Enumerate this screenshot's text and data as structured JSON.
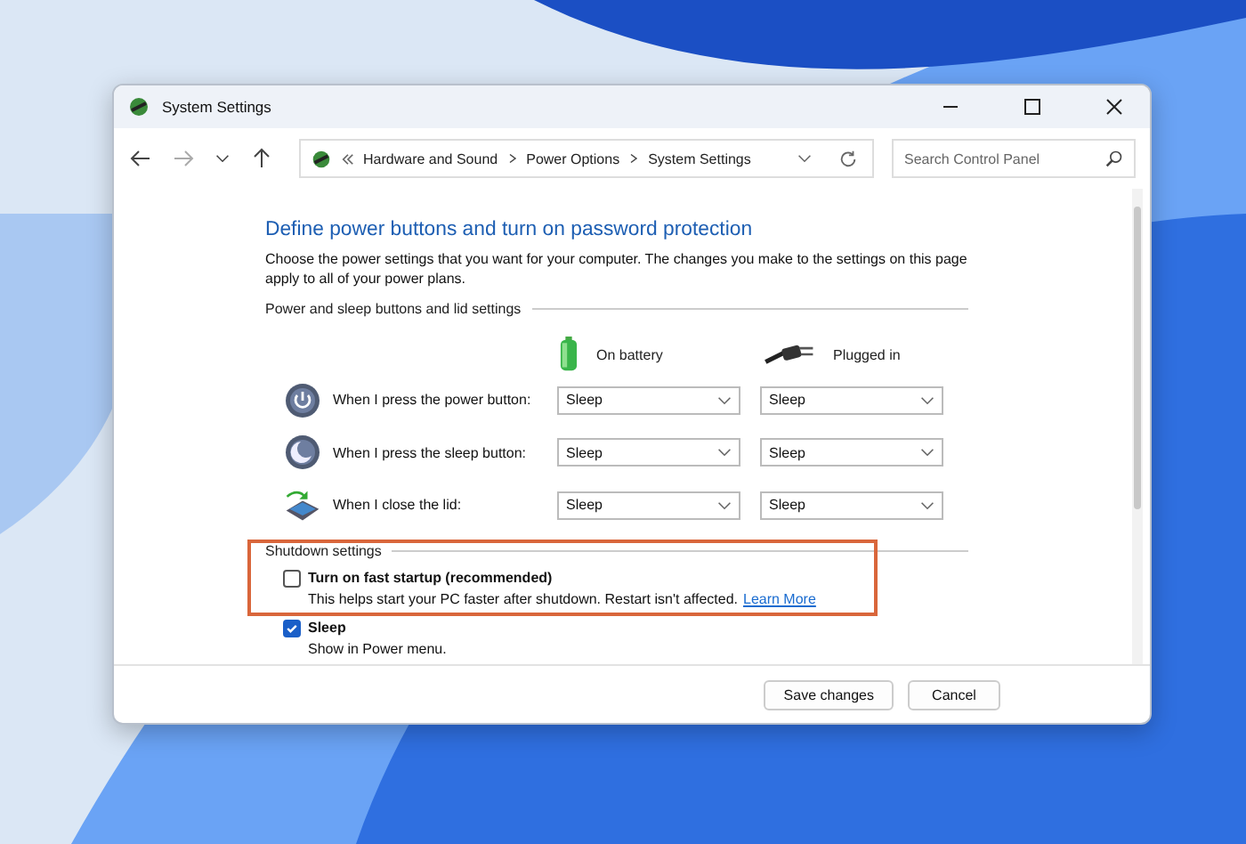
{
  "window": {
    "title": "System Settings"
  },
  "address_bar": {
    "breadcrumb": [
      "Hardware and Sound",
      "Power Options",
      "System Settings"
    ]
  },
  "search": {
    "placeholder": "Search Control Panel"
  },
  "content": {
    "heading": "Define power buttons and turn on password protection",
    "description": "Choose the power settings that you want for your computer. The changes you make to the settings on this page apply to all of your power plans.",
    "section_title": "Power and sleep buttons and lid settings",
    "columns": [
      {
        "label": "On battery",
        "kind": "battery"
      },
      {
        "label": "Plugged in",
        "kind": "plug"
      }
    ],
    "rows": [
      {
        "label": "When I press the power button:",
        "kind": "power",
        "values": [
          "Sleep",
          "Sleep"
        ]
      },
      {
        "label": "When I press the sleep button:",
        "kind": "sleep",
        "values": [
          "Sleep",
          "Sleep"
        ]
      },
      {
        "label": "When I close the lid:",
        "kind": "lid",
        "values": [
          "Sleep",
          "Sleep"
        ]
      }
    ],
    "shutdown": {
      "title": "Shutdown settings",
      "options": [
        {
          "label": "Turn on fast startup (recommended)",
          "checked": false,
          "description": "This helps start your PC faster after shutdown. Restart isn't affected.",
          "link": "Learn More"
        },
        {
          "label": "Sleep",
          "checked": true,
          "description": "Show in Power menu."
        }
      ]
    }
  },
  "buttons": [
    "Save changes",
    "Cancel"
  ]
}
